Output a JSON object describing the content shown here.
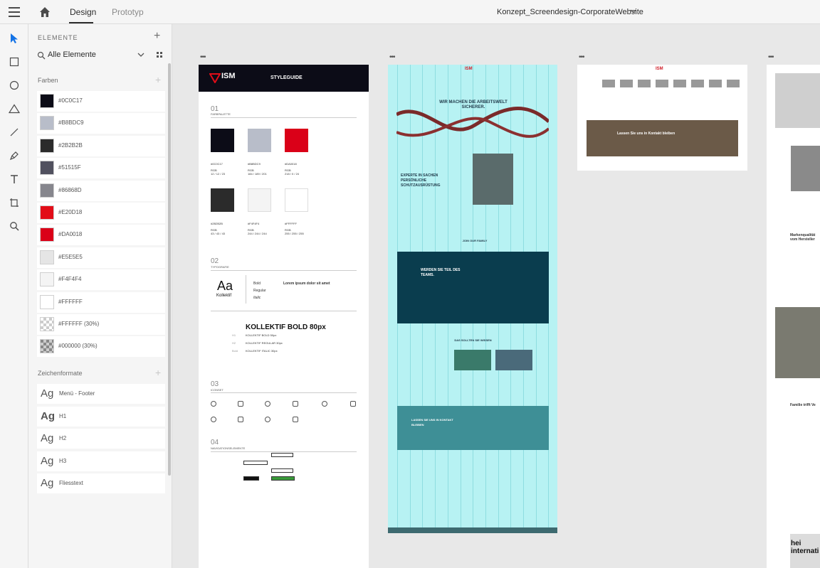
{
  "topbar": {
    "tabs": [
      {
        "label": "Design",
        "active": true
      },
      {
        "label": "Prototyp",
        "active": false
      }
    ],
    "document_title": "Konzept_Screendesign-CorporateWebsite"
  },
  "tools": [
    "select-arrow-icon",
    "rectangle-icon",
    "ellipse-icon",
    "polygon-icon",
    "line-icon",
    "pen-icon",
    "text-icon",
    "artboard-icon",
    "zoom-icon"
  ],
  "panel": {
    "heading": "ELEMENTE",
    "filter": "Alle Elemente",
    "colors_label": "Farben",
    "colors": [
      {
        "label": "#0C0C17",
        "hex": "#0C0C17"
      },
      {
        "label": "#B8BDC9",
        "hex": "#B8BDC9"
      },
      {
        "label": "#2B2B2B",
        "hex": "#2B2B2B"
      },
      {
        "label": "#51515F",
        "hex": "#51515F"
      },
      {
        "label": "#86868D",
        "hex": "#86868D"
      },
      {
        "label": "#E20D18",
        "hex": "#E20D18"
      },
      {
        "label": "#DA0018",
        "hex": "#DA0018"
      },
      {
        "label": "#E5E5E5",
        "hex": "#E5E5E5"
      },
      {
        "label": "#F4F4F4",
        "hex": "#F4F4F4"
      },
      {
        "label": "#FFFFFF",
        "hex": "#FFFFFF"
      },
      {
        "label": "#FFFFFF (30%)",
        "hex": "#FFFFFF"
      },
      {
        "label": "#000000 (30%)",
        "hex": "#000000"
      }
    ],
    "char_label": "Zeichenformate",
    "char_styles": [
      {
        "ag": "Ag",
        "label": "Menü - Footer"
      },
      {
        "ag": "Ag",
        "label": "H1"
      },
      {
        "ag": "Ag",
        "label": "H2"
      },
      {
        "ag": "Ag",
        "label": "H3"
      },
      {
        "ag": "Ag",
        "label": "Fliesstext"
      }
    ]
  },
  "styleguide": {
    "logo": "ISM",
    "logo_sub": "STORE",
    "title": "STYLEGUIDE",
    "sections": [
      {
        "num": "01",
        "label": "FARBPALETTE"
      },
      {
        "num": "02",
        "label": "TYPOGRAFIE"
      },
      {
        "num": "03",
        "label": "ICONSET"
      },
      {
        "num": "04",
        "label": "NAVIGATIONSELEMENTE"
      }
    ],
    "swatches": [
      {
        "hex": "#0C0C17",
        "code": "#0C0C17",
        "rgb": "12 / 12 / 23"
      },
      {
        "hex": "#B8BDC9",
        "code": "#B8BDC9",
        "rgb": "184 / 189 / 201"
      },
      {
        "hex": "#DA0018",
        "code": "#DA0018",
        "rgb": "218 / 0 / 24"
      },
      {
        "hex": "#2B2B2B",
        "code": "#2B2B2B",
        "rgb": "43 / 43 / 43"
      },
      {
        "hex": "#F4F4F4",
        "code": "#F4F4F4",
        "rgb": "244 / 244 / 244"
      },
      {
        "hex": "#FFFFFF",
        "code": "#FFFFFF",
        "rgb": "255 / 255 / 255"
      }
    ],
    "rgb_label": "RGB",
    "type_specimen": "Aa",
    "type_family": "Kollektif",
    "type_weights": [
      "Bold",
      "Regular",
      "Italic"
    ],
    "type_sample": "Lorem ipsum dolor sit amet",
    "heading_sample": "KOLLEKTIF BOLD 80px",
    "type_scale": [
      {
        "tag": "H1",
        "text": "KOLLEKTIF BOLD 50px"
      },
      {
        "tag": "H2",
        "text": "KOLLEKTIF REGULAR 30px"
      },
      {
        "tag": "Bold",
        "text": "KOLLEKTIF ITALIC 30px"
      }
    ]
  },
  "homepage": {
    "logo": "ISM",
    "hero": "WIR MACHEN DIE ARBEITSWELT SICHERER.",
    "intro": "EXPERTE IN SACHEN PERSÖNLICHE SCHUTZAUSRÜSTUNG",
    "family": "JOIN OUR FAMILY",
    "team": "WERDEN SIE TEIL DES TEAMS.",
    "know": "DAS SOLLTEN SIE WISSEN",
    "contact": "LASSEN SIE UNS IN KONTAKT BLEIBEN"
  },
  "smallboard": {
    "logo": "ISM",
    "banner": "Lassen Sie uns in Kontakt bleiben"
  },
  "partial": {
    "heading1": "Markenqualität vom Hersteller",
    "heading2": "Familie trifft Ve",
    "footer": "hei internati"
  }
}
